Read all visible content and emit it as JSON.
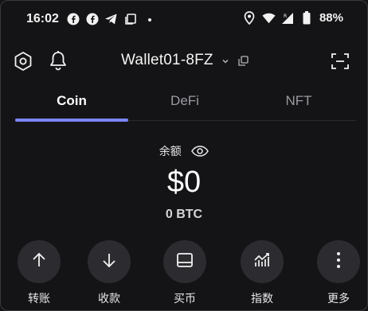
{
  "status_bar": {
    "time": "16:02",
    "battery_text": "88%",
    "left_icons": [
      "facebook-icon",
      "facebook-icon",
      "telegram-icon",
      "copy-icon",
      "dot-icon"
    ],
    "right_icons": [
      "location-icon",
      "wifi-icon",
      "signal-icon",
      "battery-icon"
    ]
  },
  "header": {
    "wallet_name": "Wallet01-8FZ"
  },
  "tabs": [
    {
      "label": "Coin",
      "active": true
    },
    {
      "label": "DeFi",
      "active": false
    },
    {
      "label": "NFT",
      "active": false
    }
  ],
  "balance": {
    "label": "余额",
    "value": "$0",
    "btc": "0 BTC"
  },
  "actions": [
    {
      "label": "转账",
      "icon": "arrow-up-icon"
    },
    {
      "label": "收款",
      "icon": "arrow-down-icon"
    },
    {
      "label": "买币",
      "icon": "card-icon"
    },
    {
      "label": "指数",
      "icon": "chart-icon"
    },
    {
      "label": "更多",
      "icon": "more-vertical-icon"
    }
  ],
  "colors": {
    "background": "#141416",
    "accent": "#7b86ff",
    "button_bg": "#2c2c30",
    "muted_text": "#9a9aa0"
  }
}
